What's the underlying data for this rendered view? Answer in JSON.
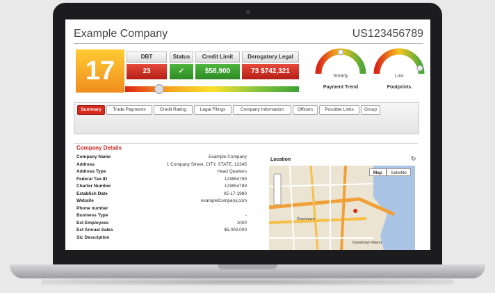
{
  "header": {
    "company_name": "Example Company",
    "company_id": "US123456789"
  },
  "score": {
    "value": "17"
  },
  "metrics": [
    {
      "label": "DBT",
      "value": "23",
      "color": "#c9291c"
    },
    {
      "label": "Status",
      "value": "✓",
      "color": "#3b9e2e"
    },
    {
      "label": "Credit Limit",
      "value": "$58,900",
      "color": "#3b9e2e"
    },
    {
      "label": "Derogatory Legal",
      "value": "73  $742,321",
      "color": "#c9291c"
    }
  ],
  "gauges": [
    {
      "value": "Steady",
      "label": "Payment Trend"
    },
    {
      "value": "Low",
      "label": "Footprints"
    }
  ],
  "tabs": [
    {
      "label": "Summary",
      "active": true
    },
    {
      "label": "Trade Payments"
    },
    {
      "label": "Credit Rating"
    },
    {
      "label": "Legal Filings"
    },
    {
      "label": "Company Information"
    },
    {
      "label": "Officers"
    },
    {
      "label": "Possible Links"
    },
    {
      "label": "Group"
    }
  ],
  "details": {
    "title": "Company Details",
    "rows": [
      {
        "key": "Company Name",
        "value": "Example Company"
      },
      {
        "key": "Address",
        "value": "1 Company Street, CITY, STATE, 12345"
      },
      {
        "key": "Address Type",
        "value": "Head Quarters"
      },
      {
        "key": "Federal Tax-ID",
        "value": "123654789"
      },
      {
        "key": "Charter Number",
        "value": "123654789"
      },
      {
        "key": "Establish Date",
        "value": "05-17-1980"
      },
      {
        "key": "Website",
        "value": "exampleCompany.com"
      },
      {
        "key": "Phone number",
        "value": ""
      },
      {
        "key": "Business Type",
        "value": "-"
      },
      {
        "key": "Est Employees",
        "value": "1000"
      },
      {
        "key": "Est Annual Sales",
        "value": "$5,000,000"
      },
      {
        "key": "Sic Description",
        "value": ""
      }
    ]
  },
  "location": {
    "title": "Location",
    "map_button": "Map",
    "satellite_button": "Satellite",
    "labels": [
      "Downtown",
      "Downtown Miami"
    ]
  }
}
